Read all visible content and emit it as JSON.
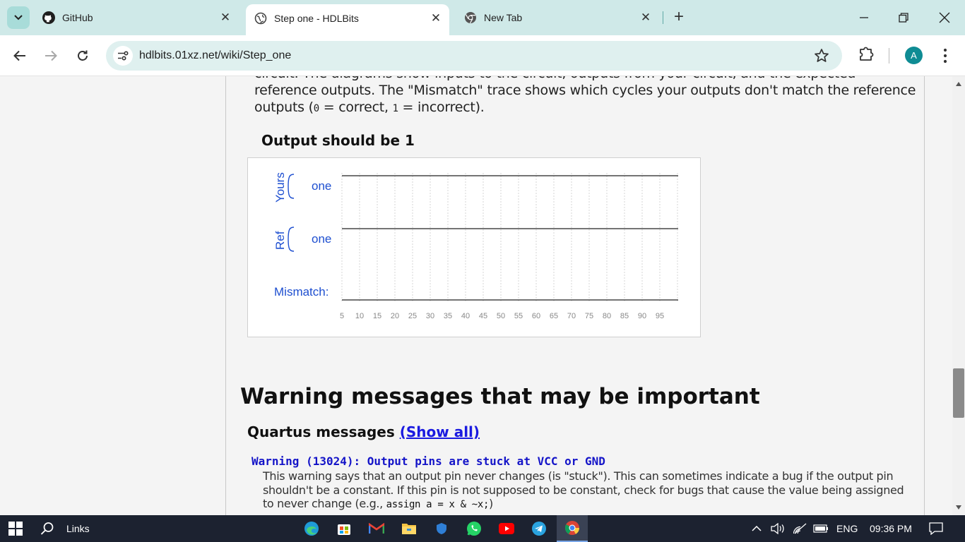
{
  "browser": {
    "tabs": [
      {
        "title": "GitHub",
        "icon": "github-icon"
      },
      {
        "title": "Step one - HDLBits",
        "icon": "globe-icon",
        "active": true
      },
      {
        "title": "New Tab",
        "icon": "chrome-icon"
      }
    ],
    "url": "hdlbits.01xz.net/wiki/Step_one",
    "profile_initial": "A"
  },
  "page": {
    "intro_partial_line": "circuit. The diagrams show inputs to the circuit, outputs from your circuit, and the expected",
    "intro_line2": "reference outputs. The \"Mismatch\" trace shows which cycles your outputs don't match the reference",
    "intro_line3_a": "outputs (",
    "intro_code_0": "0",
    "intro_line3_b": " = correct, ",
    "intro_code_1": "1",
    "intro_line3_c": " = incorrect).",
    "output_heading": "Output should be 1",
    "waveform": {
      "yours_label": "Yours",
      "ref_label": "Ref",
      "yours_signal": "one",
      "ref_signal": "one",
      "mismatch_label": "Mismatch:",
      "ticks": [
        "5",
        "10",
        "15",
        "20",
        "25",
        "30",
        "35",
        "40",
        "45",
        "50",
        "55",
        "60",
        "65",
        "70",
        "75",
        "80",
        "85",
        "90",
        "95"
      ]
    },
    "warnings_heading": "Warning messages that may be important",
    "quartus_heading": "Quartus messages",
    "show_all_link": "(Show all)",
    "warning_title": "Warning (13024): Output pins are stuck at VCC or GND",
    "warning_body_1": "This warning says that an output pin never changes (is \"stuck\"). This can sometimes indicate a bug if the output pin shouldn't be a constant. If this pin is not supposed to be constant, check for bugs that cause the value being assigned to never change (e.g., ",
    "warning_code": "assign a = x & ~x;",
    "warning_body_2": ")"
  },
  "taskbar": {
    "search_label": "Links",
    "language": "ENG",
    "time": "09:36 PM"
  }
}
